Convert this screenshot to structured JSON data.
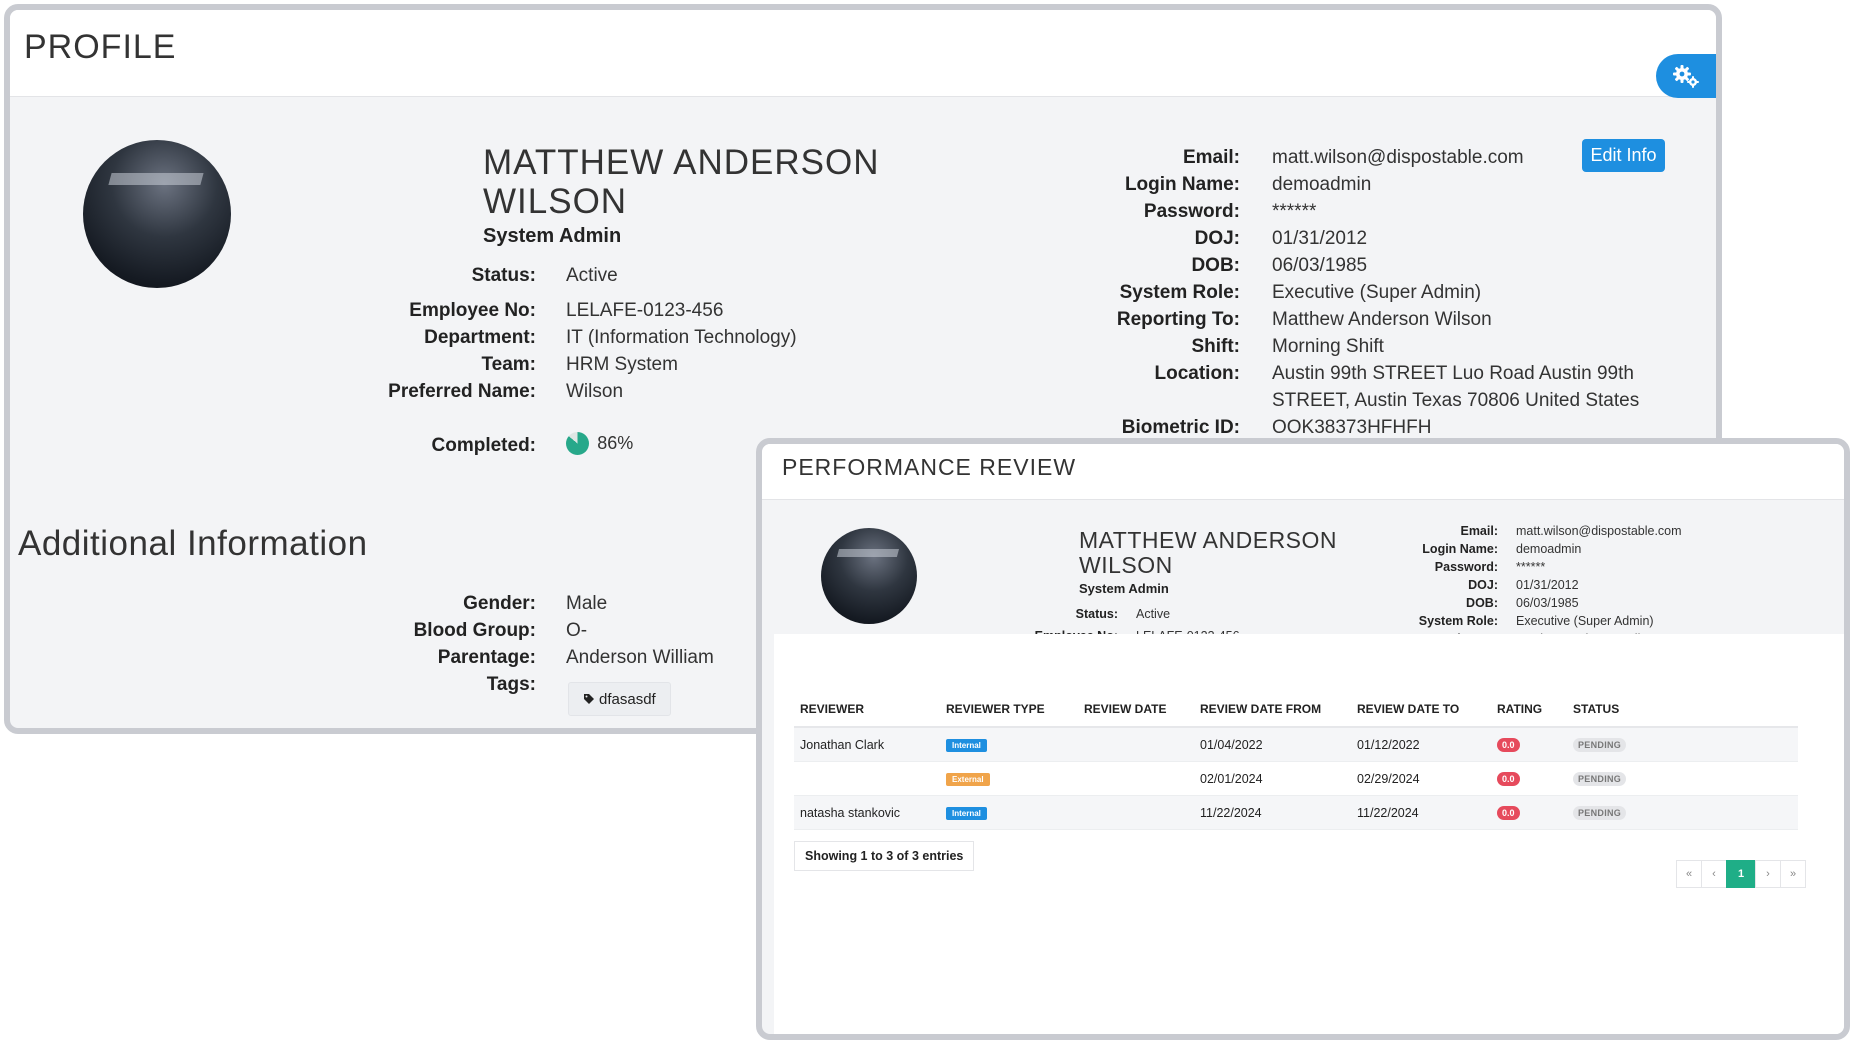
{
  "profile": {
    "title": "PROFILE",
    "name_line1": "MATTHEW ANDERSON",
    "name_line2": "WILSON",
    "role": "System Admin",
    "left_fields": [
      {
        "label": "Status:",
        "value": "Active"
      },
      {
        "label": "Employee No:",
        "value": "LELAFE-0123-456"
      },
      {
        "label": "Department:",
        "value": "IT (Information Technology)"
      },
      {
        "label": "Team:",
        "value": "HRM System"
      },
      {
        "label": "Preferred Name:",
        "value": "Wilson"
      }
    ],
    "completed_label": "Completed:",
    "completed_value": "86%",
    "completed_fraction": 0.86,
    "right_fields": [
      {
        "label": "Email:",
        "value": "matt.wilson@dispostable.com"
      },
      {
        "label": "Login Name:",
        "value": "demoadmin"
      },
      {
        "label": "Password:",
        "value": "******"
      },
      {
        "label": "DOJ:",
        "value": "01/31/2012"
      },
      {
        "label": "DOB:",
        "value": "06/03/1985"
      },
      {
        "label": "System Role:",
        "value": "Executive (Super Admin)"
      },
      {
        "label": "Reporting To:",
        "value": "Matthew Anderson Wilson"
      },
      {
        "label": "Shift:",
        "value": "Morning Shift"
      },
      {
        "label": "Location:",
        "value_line1": "Austin 99th STREET Luo Road Austin 99th",
        "value_line2": "STREET, Austin Texas 70806 United States"
      },
      {
        "label": "Biometric ID:",
        "value": "OOK38373HFHFH"
      }
    ],
    "edit_button": "Edit Info",
    "additional_title": "Additional Information",
    "additional_fields": [
      {
        "label": "Gender:",
        "value": "Male"
      },
      {
        "label": "Blood Group:",
        "value": "O-"
      },
      {
        "label": "Parentage:",
        "value": "Anderson William"
      }
    ],
    "tags_label": "Tags:",
    "tag": "dfasasdf"
  },
  "review": {
    "title": "PERFORMANCE REVIEW",
    "table": {
      "headers": [
        "REVIEWER",
        "REVIEWER TYPE",
        "REVIEW DATE",
        "REVIEW DATE FROM",
        "REVIEW DATE TO",
        "RATING",
        "STATUS"
      ],
      "rows": [
        {
          "reviewer": "Jonathan Clark",
          "type": "Internal",
          "review_date": "",
          "from": "01/04/2022",
          "to": "01/12/2022",
          "rating": "0.0",
          "status": "PENDING"
        },
        {
          "reviewer": "",
          "type": "External",
          "review_date": "",
          "from": "02/01/2024",
          "to": "02/29/2024",
          "rating": "0.0",
          "status": "PENDING"
        },
        {
          "reviewer": "natasha stankovic",
          "type": "Internal",
          "review_date": "",
          "from": "11/22/2024",
          "to": "11/22/2024",
          "rating": "0.0",
          "status": "PENDING"
        }
      ]
    },
    "info": "Showing 1 to 3 of 3 entries",
    "pager": {
      "first": "«",
      "prev": "‹",
      "page": "1",
      "next": "›",
      "last": "»"
    }
  },
  "colors": {
    "accent": "#1e8fe0",
    "success": "#1fae87",
    "danger": "#e64a5c",
    "warning": "#f0a44a"
  },
  "icons": {
    "settings": "gears-icon",
    "tag": "tag-icon"
  }
}
